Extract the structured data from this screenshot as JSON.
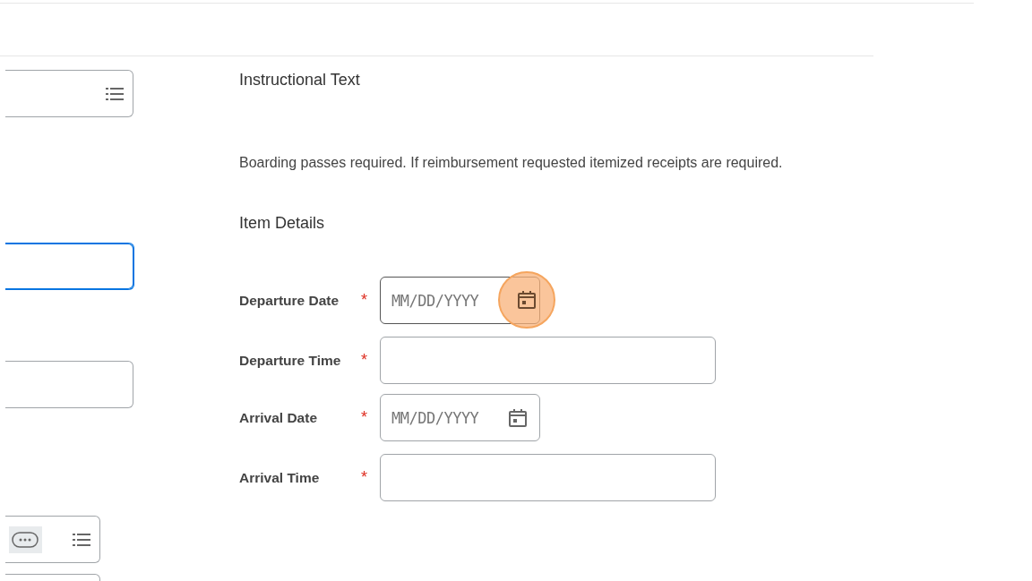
{
  "left_fields": [
    {
      "kind": "list",
      "focused": false
    },
    {
      "kind": "text",
      "focused": true
    },
    {
      "kind": "text",
      "focused": false
    },
    {
      "kind": "chip-list",
      "focused": false
    },
    {
      "kind": "text",
      "focused": false
    }
  ],
  "instructions": {
    "heading": "Instructional Text",
    "body": "Boarding passes required. If reimbursement requested itemized receipts are required."
  },
  "item_details": {
    "heading": "Item Details",
    "fields": [
      {
        "label": "Departure Date",
        "required_mark": "*",
        "kind": "date",
        "placeholder": "MM/DD/YYYY",
        "highlighted": true
      },
      {
        "label": "Departure Time",
        "required_mark": "*",
        "kind": "time",
        "highlighted": false
      },
      {
        "label": "Arrival Date",
        "required_mark": "*",
        "kind": "date",
        "placeholder": "MM/DD/YYYY",
        "highlighted": false
      },
      {
        "label": "Arrival Time",
        "required_mark": "*",
        "kind": "time",
        "highlighted": false
      }
    ]
  }
}
